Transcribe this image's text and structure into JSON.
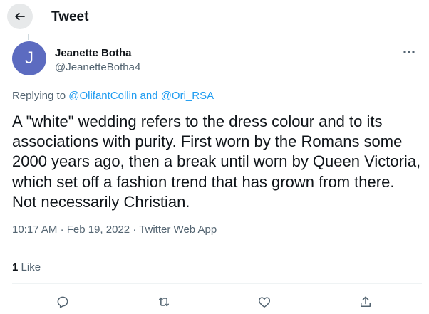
{
  "header": {
    "title": "Tweet",
    "back_icon": "arrow-left-icon"
  },
  "author": {
    "avatar_letter": "J",
    "avatar_color": "#5c6bc0",
    "name": "Jeanette Botha",
    "handle": "@JeanetteBotha4"
  },
  "replying": {
    "prefix": "Replying to",
    "user1": "@OlifantCollin",
    "conjunction": "and",
    "user2": "@Ori_RSA"
  },
  "tweet": {
    "text": "A \"white\" wedding refers to the dress colour and to its associations with purity. First worn by the Romans some 2000 years ago, then a break until worn by Queen Victoria, which set off a fashion trend that has grown from there. Not necessarily Christian."
  },
  "meta": {
    "time": "10:17 AM",
    "separator": "·",
    "date": "Feb 19, 2022",
    "app": "Twitter Web App"
  },
  "stats": {
    "like_count": "1",
    "like_label": "Like"
  },
  "actions": [
    "reply-icon",
    "retweet-icon",
    "like-icon",
    "share-icon"
  ],
  "colors": {
    "link": "#1d9bf0",
    "secondary_text": "#536471",
    "primary_text": "#0f1419"
  }
}
